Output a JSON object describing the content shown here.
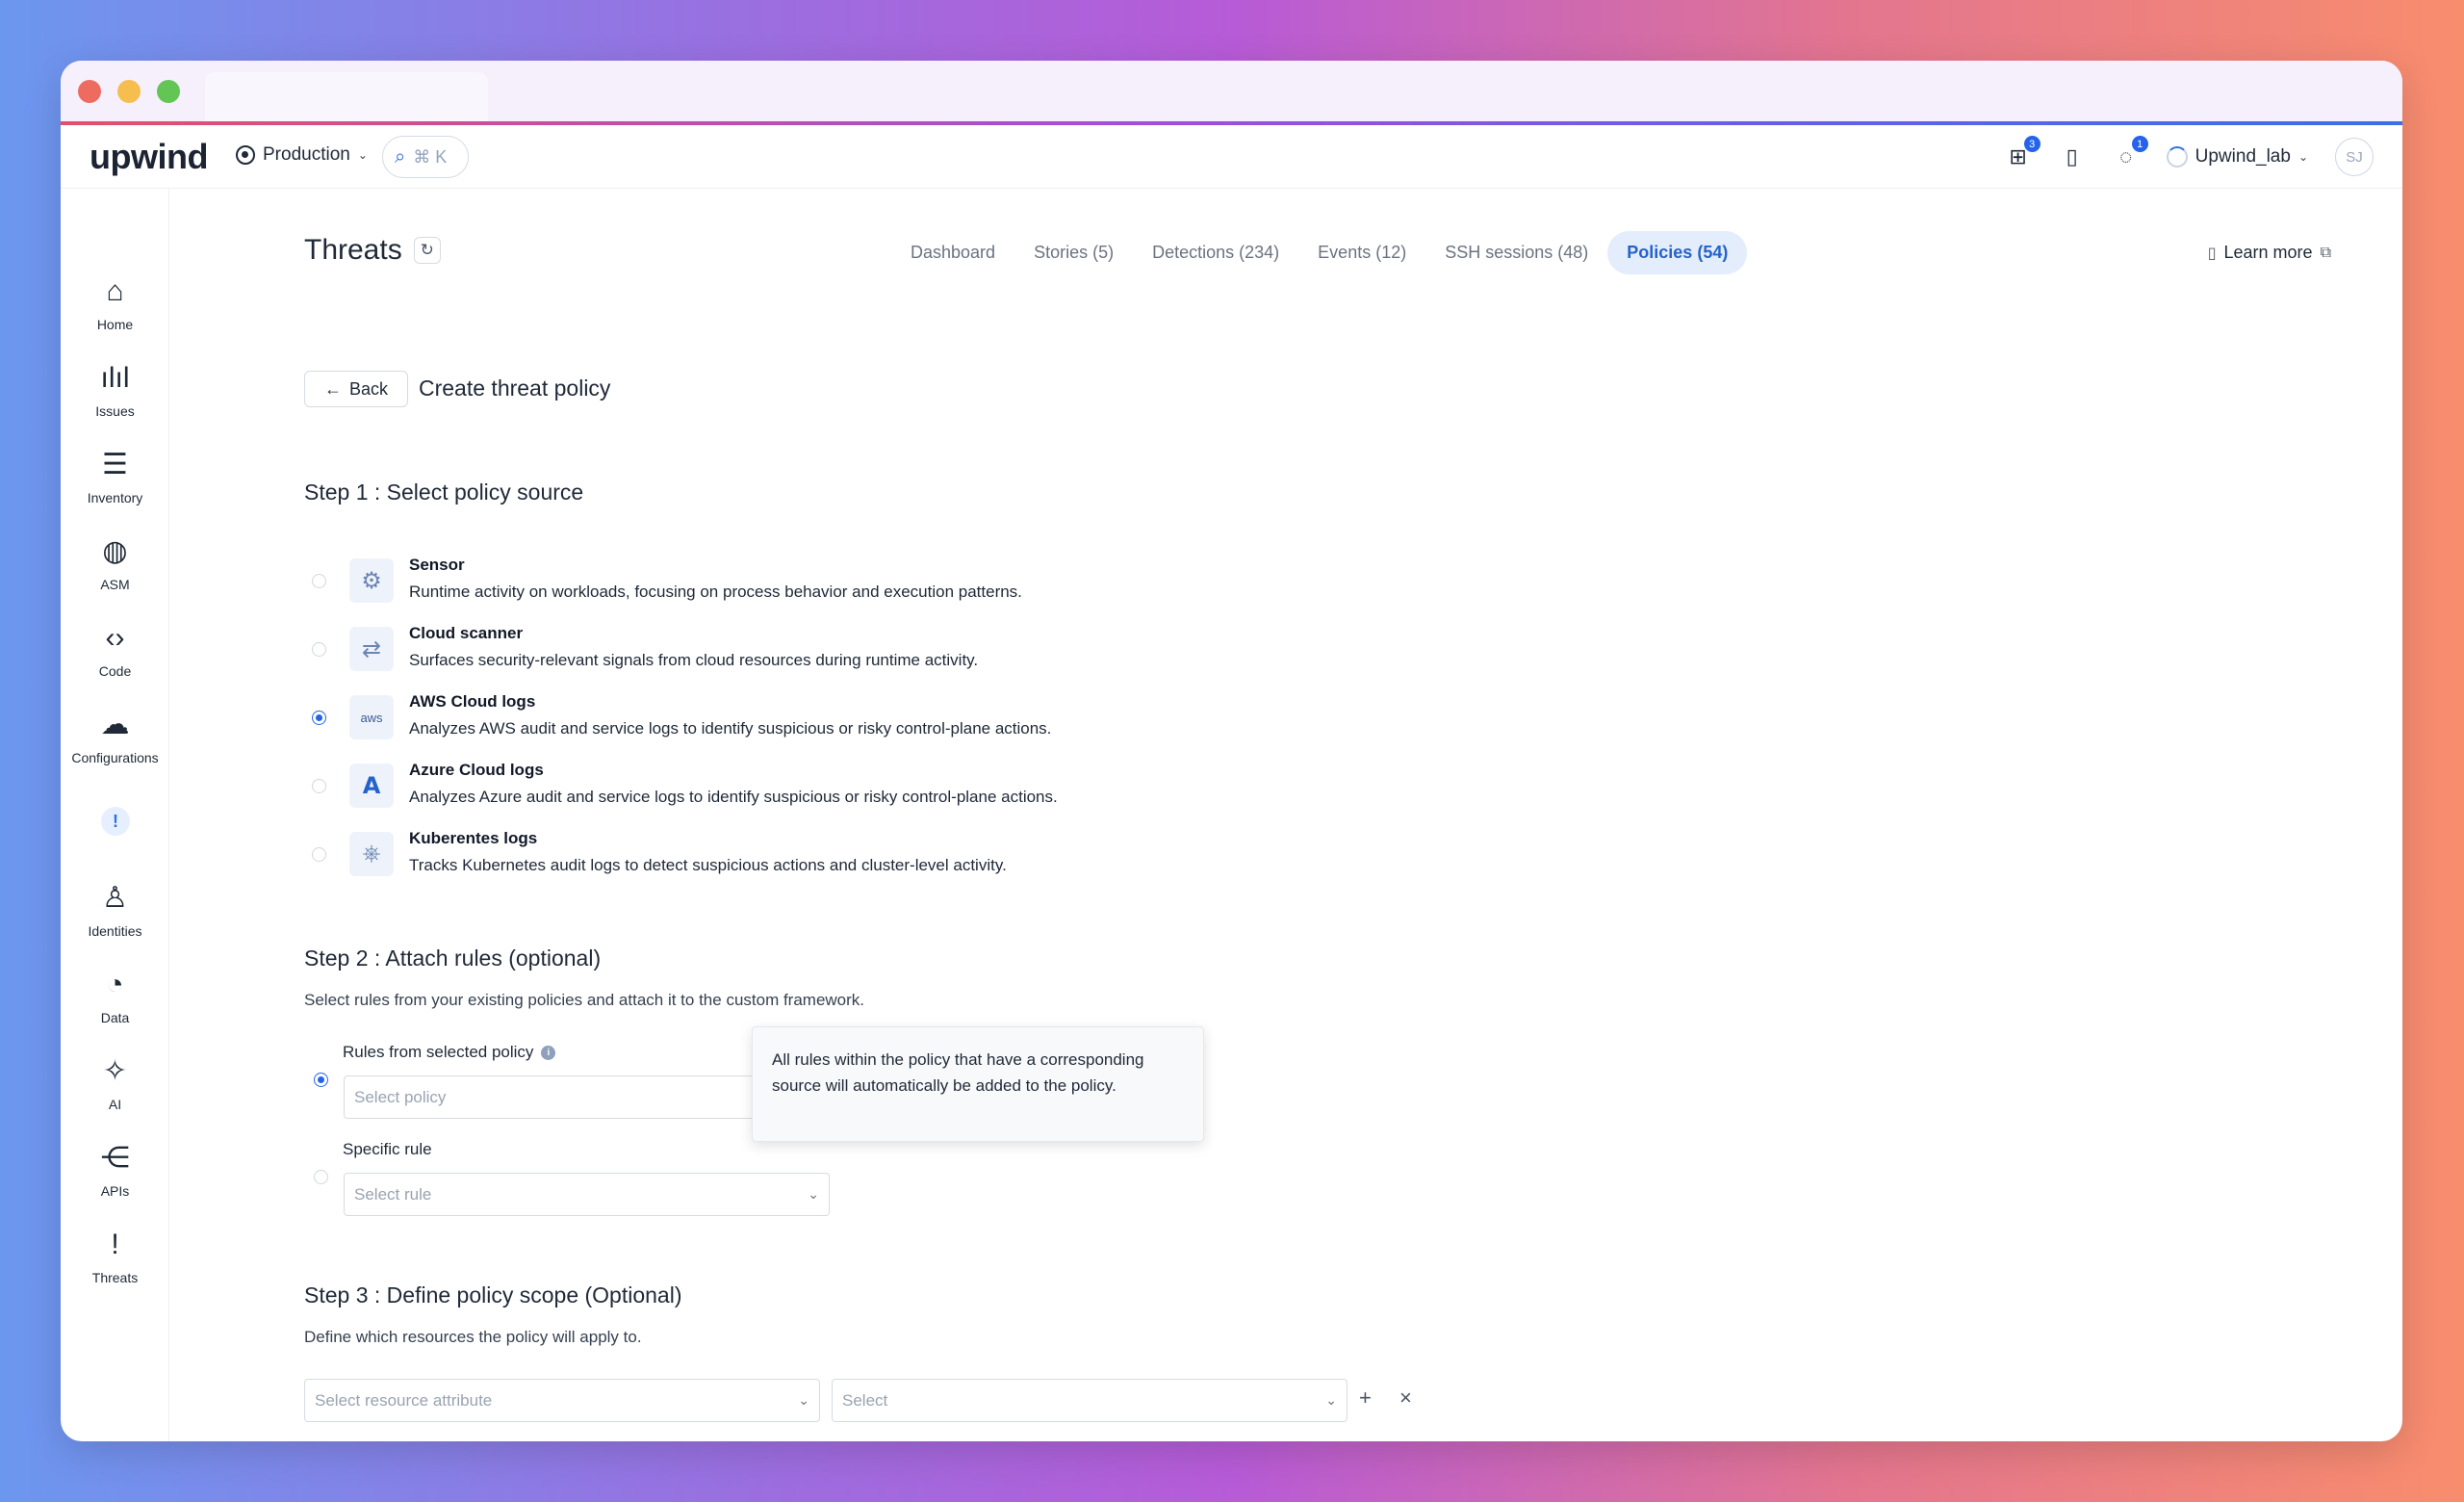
{
  "app": {
    "logo": "upwind",
    "environment": "Production",
    "search_shortcut": "⌘ K",
    "gift_badge": "3",
    "chat_badge": "1",
    "org_name": "Upwind_lab",
    "avatar_initials": "SJ"
  },
  "sidebar": {
    "items": [
      {
        "label": "Home",
        "icon": "home-icon"
      },
      {
        "label": "Issues",
        "icon": "issues-icon"
      },
      {
        "label": "Inventory",
        "icon": "inventory-icon"
      },
      {
        "label": "ASM",
        "icon": "globe-icon"
      },
      {
        "label": "Code",
        "icon": "code-icon"
      },
      {
        "label": "Configurations",
        "icon": "cloud-icon"
      },
      {
        "label": "Identities",
        "icon": "user-icon"
      },
      {
        "label": "Data",
        "icon": "pie-icon"
      },
      {
        "label": "AI",
        "icon": "sparkle-icon"
      },
      {
        "label": "APIs",
        "icon": "share-icon"
      },
      {
        "label": "Threats",
        "icon": "exclamation-icon"
      }
    ],
    "alert_glyph": "!"
  },
  "page": {
    "title": "Threats",
    "tabs": [
      {
        "label": "Dashboard",
        "active": false
      },
      {
        "label": "Stories (5)",
        "active": false
      },
      {
        "label": "Detections (234)",
        "active": false
      },
      {
        "label": "Events (12)",
        "active": false
      },
      {
        "label": "SSH sessions (48)",
        "active": false
      },
      {
        "label": "Policies (54)",
        "active": true
      }
    ],
    "learn_more": "Learn more",
    "back_label": "Back",
    "subtitle": "Create threat policy"
  },
  "step1": {
    "title": "Step 1 :  Select policy source",
    "sources": [
      {
        "name": "Sensor",
        "desc": "Runtime activity on workloads, focusing on process behavior and execution patterns.",
        "icon": "sensor-icon",
        "selected": false
      },
      {
        "name": "Cloud scanner",
        "desc": "Surfaces security-relevant signals from cloud resources during runtime activity.",
        "icon": "scanner-icon",
        "selected": false
      },
      {
        "name": "AWS Cloud logs",
        "desc": "Analyzes AWS audit and service logs to identify suspicious or risky control-plane actions.",
        "icon": "aws-icon",
        "selected": true
      },
      {
        "name": "Azure Cloud logs",
        "desc": "Analyzes Azure audit and service logs to identify suspicious or risky control-plane actions.",
        "icon": "azure-icon",
        "selected": false
      },
      {
        "name": "Kuberentes logs",
        "desc": "Tracks Kubernetes audit logs to detect suspicious actions and cluster-level activity.",
        "icon": "kubernetes-icon",
        "selected": false
      }
    ]
  },
  "step2": {
    "title": "Step 2 :  Attach rules (optional)",
    "desc": "Select rules from your existing policies and attach it to the custom framework.",
    "rules_from_policy_label": "Rules from selected policy",
    "select_policy_placeholder": "Select policy",
    "specific_rule_label": "Specific rule",
    "select_rule_placeholder": "Select rule",
    "tooltip": "All rules within the policy that have a corresponding source will automatically be added to the policy."
  },
  "step3": {
    "title": "Step 3 :  Define policy scope (Optional)",
    "desc": "Define which resources the policy will apply to.",
    "attribute_placeholder": "Select resource attribute",
    "value_placeholder": "Select",
    "add_glyph": "+",
    "remove_glyph": "×"
  }
}
